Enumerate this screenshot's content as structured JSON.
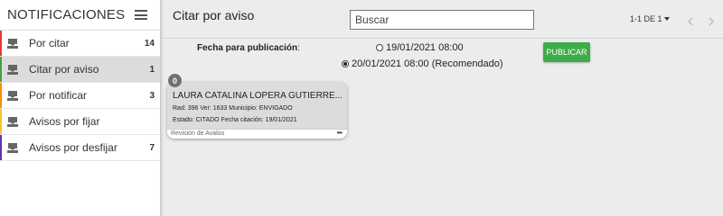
{
  "sidebar": {
    "title": "NOTIFICACIONES",
    "items": [
      {
        "label": "Por citar",
        "count": "14",
        "accent": "#e53935"
      },
      {
        "label": "Citar por aviso",
        "count": "1",
        "accent": "#43a047"
      },
      {
        "label": "Por notificar",
        "count": "3",
        "accent": "#fb8c00"
      },
      {
        "label": "Avisos por fijar",
        "count": "",
        "accent": "#fbc02d"
      },
      {
        "label": "Avisos por desfijar",
        "count": "7",
        "accent": "#5e35b1"
      }
    ]
  },
  "header": {
    "title": "Citar por aviso",
    "search_placeholder": "Buscar",
    "pagination": "1-1 DE 1"
  },
  "publication": {
    "label": "Fecha para publicación",
    "label_suffix": ":",
    "options": [
      {
        "text": "19/01/2021 08:00",
        "checked": false
      },
      {
        "text": "20/01/2021 08:00 (Recomendado)",
        "checked": true
      }
    ],
    "publish_button": "PUBLICAR"
  },
  "cards": [
    {
      "badge": "0",
      "name": "LAURA CATALINA LOPERA GUTIERRE...",
      "line1": "Rad: 396 Ver: 1633 Municipio: ENVIGADO",
      "line2": "Estado: CITADO Fecha citación: 19/01/2021",
      "footer": "Revisión de Avalúo",
      "more": "•••"
    }
  ],
  "colors": {
    "publish_green": "#3dad4a",
    "active_item_bg": "#dcdcdc"
  }
}
